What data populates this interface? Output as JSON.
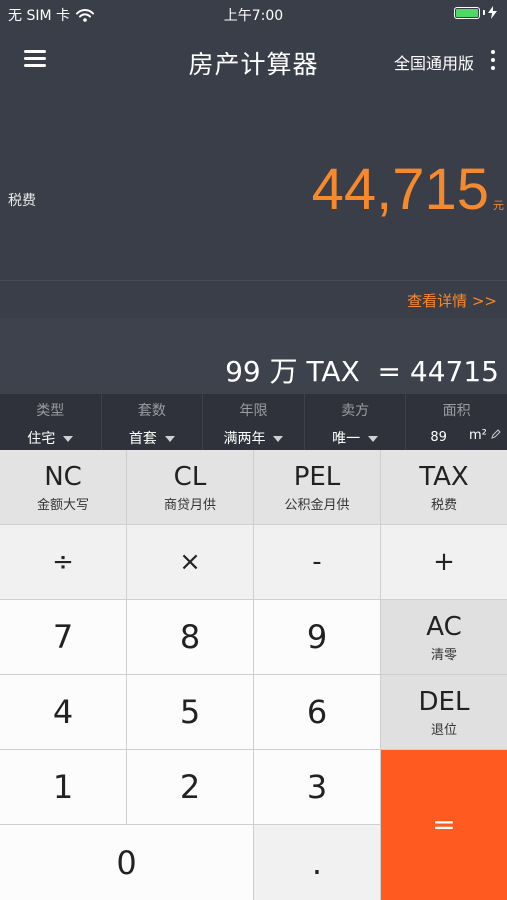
{
  "status": {
    "carrier": "无 SIM 卡",
    "time": "上午7:00"
  },
  "nav": {
    "title": "房产计算器",
    "edition": "全国通用版"
  },
  "result": {
    "label": "税费",
    "value": "44,715",
    "unit": "元",
    "details_link": "查看详情 >>"
  },
  "expression": "99 万 TAX  = 44715",
  "params": [
    {
      "label": "类型",
      "value": "住宅"
    },
    {
      "label": "套数",
      "value": "首套"
    },
    {
      "label": "年限",
      "value": "满两年"
    },
    {
      "label": "卖方",
      "value": "唯一"
    },
    {
      "label": "面积",
      "value": "89",
      "unit": "m²"
    }
  ],
  "keys": {
    "nc": {
      "main": "NC",
      "sub": "金额大写"
    },
    "cl": {
      "main": "CL",
      "sub": "商贷月供"
    },
    "pel": {
      "main": "PEL",
      "sub": "公积金月供"
    },
    "tax": {
      "main": "TAX",
      "sub": "税费"
    },
    "divide": "÷",
    "multiply": "×",
    "minus": "-",
    "plus": "+",
    "ac": {
      "main": "AC",
      "sub": "清零"
    },
    "del": {
      "main": "DEL",
      "sub": "退位"
    },
    "n7": "7",
    "n8": "8",
    "n9": "9",
    "n4": "4",
    "n5": "5",
    "n6": "6",
    "n1": "1",
    "n2": "2",
    "n3": "3",
    "n0": "0",
    "dot": ".",
    "equals": "="
  },
  "colors": {
    "accent": "#f7892d",
    "equals": "#ff5a1f",
    "background": "#3a3e48"
  }
}
